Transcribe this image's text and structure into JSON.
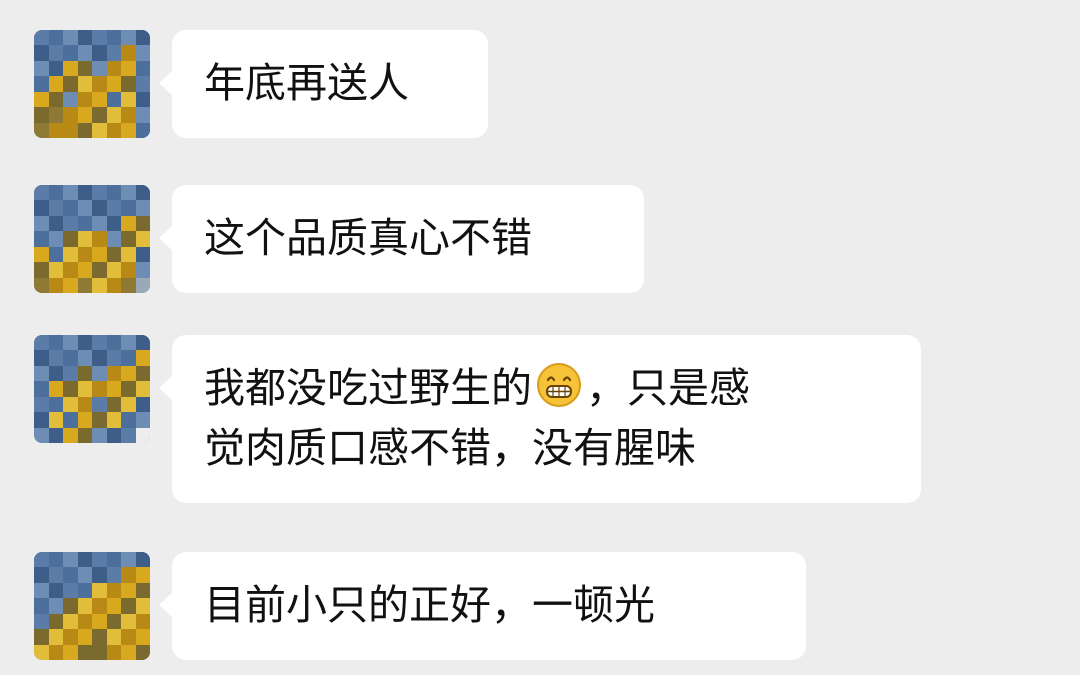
{
  "chat": {
    "messages": [
      {
        "lines": [
          "年底再送人"
        ]
      },
      {
        "lines": [
          "这个品质真心不错"
        ]
      },
      {
        "lines": [
          "我都没吃过野生的",
          "，只是感",
          "觉肉质口感不错，没有腥味"
        ],
        "emoji": "grinning-face-emoji"
      },
      {
        "lines": [
          "目前小只的正好，一顿光"
        ]
      }
    ]
  },
  "colors": {
    "background": "#ededed",
    "bubble": "#ffffff",
    "text": "#111111",
    "avatar_blue": "#4f6f98",
    "avatar_yellow": "#d6a41e"
  }
}
